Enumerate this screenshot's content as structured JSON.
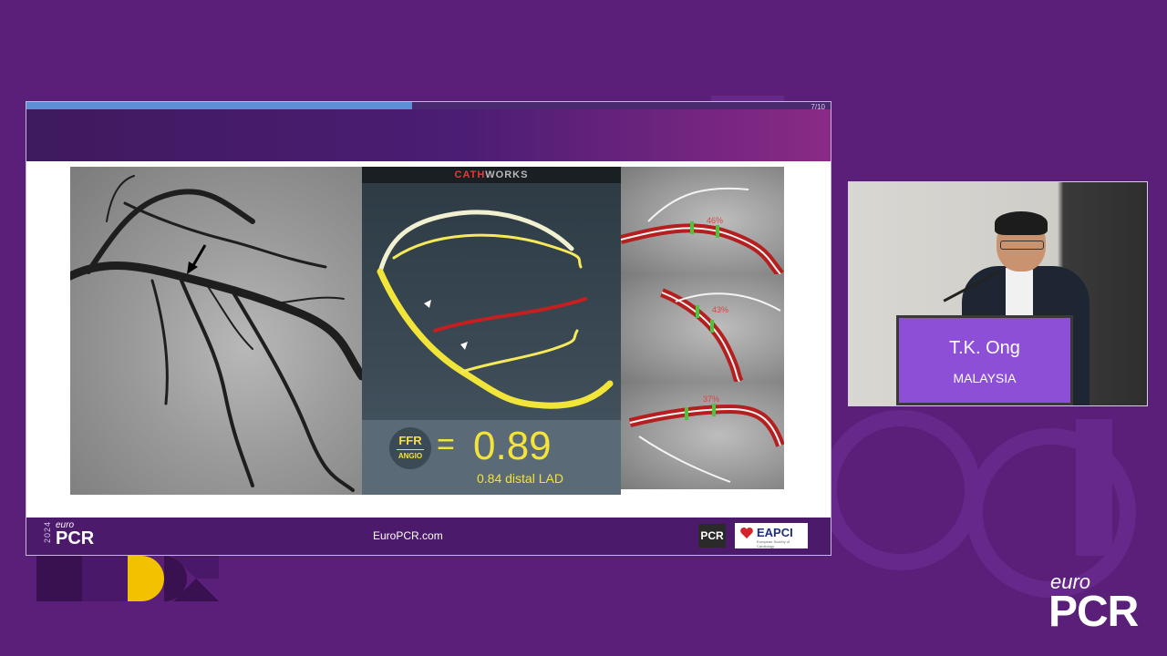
{
  "slide": {
    "page_indicator": "7/10",
    "progress": 0.48,
    "cathworks_part1": "CATH",
    "cathworks_part2": "WORKS",
    "ffr_top": "FFR",
    "ffr_bottom": "ANGIO",
    "ffr_equals": "=",
    "ffr_value": "0.89",
    "ffr_subtext": "0.84 distal LAD",
    "stenosis_labels": [
      "46%",
      "43%",
      "37%"
    ],
    "footer": {
      "year": "2024",
      "logo_euro": "euro",
      "logo_pcr": "PCR",
      "url": "EuroPCR.com",
      "pcr_badge": "PCR",
      "eapci": "EAPCI",
      "eapci_small": "European Society of Cardiology"
    }
  },
  "speaker": {
    "name": "T.K. Ong",
    "country": "MALAYSIA"
  },
  "corner_logo": {
    "euro": "euro",
    "pcr": "PCR"
  },
  "colors": {
    "background": "#5a1f78",
    "ffr_yellow": "#f4e33a",
    "podium": "#8d4fd6",
    "cath_red": "#e83a3a"
  }
}
